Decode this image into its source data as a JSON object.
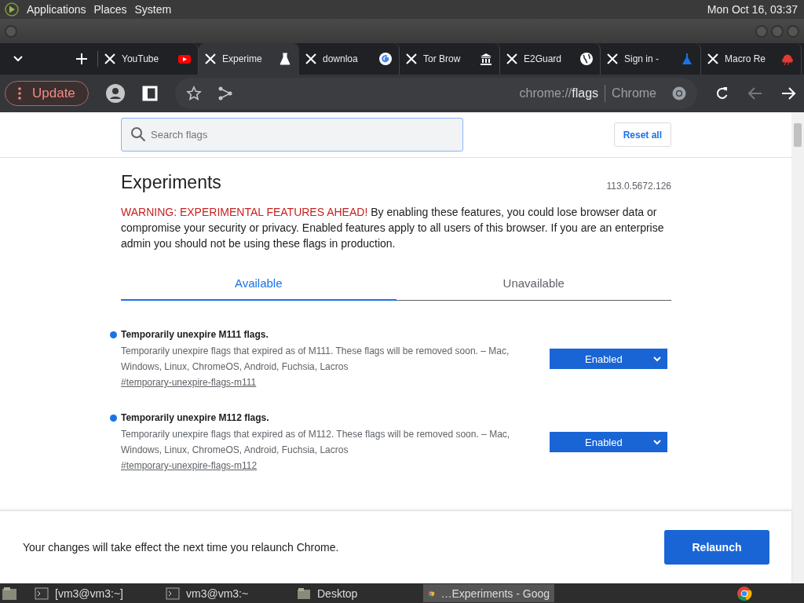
{
  "top_panel": {
    "menus": [
      "Applications",
      "Places",
      "System"
    ],
    "clock": "Mon Oct 16, 03:37"
  },
  "tabs": [
    {
      "title": "YouTube",
      "selected": false
    },
    {
      "title": "Experime",
      "selected": true
    },
    {
      "title": "downloa",
      "selected": false
    },
    {
      "title": "Tor Brow",
      "selected": false
    },
    {
      "title": "E2Guard",
      "selected": false
    },
    {
      "title": "Sign in - ",
      "selected": false
    },
    {
      "title": "Macro Re",
      "selected": false
    }
  ],
  "toolbar": {
    "update_label": "Update",
    "url_scheme": "chrome://",
    "url_path": "flags",
    "url_site": "Chrome"
  },
  "search": {
    "placeholder": "Search flags"
  },
  "reset_label": "Reset all",
  "heading": "Experiments",
  "version": "113.0.5672.126",
  "warning_lead": "WARNING: EXPERIMENTAL FEATURES AHEAD!",
  "warning_text": "By enabling these features, you could lose browser data or compromise your security or privacy. Enabled features apply to all users of this browser. If you are an enterprise admin you should not be using these flags in production.",
  "view_tabs": [
    {
      "label": "Available",
      "selected": true
    },
    {
      "label": "Unavailable",
      "selected": false
    }
  ],
  "flags": [
    {
      "title": "Temporarily unexpire M111 flags.",
      "description": "Temporarily unexpire flags that expired as of M111. These flags will be removed soon. – Mac, Windows, Linux, ChromeOS, Android, Fuchsia, Lacros",
      "link": "#temporary-unexpire-flags-m111",
      "value": "Enabled",
      "modified": true
    },
    {
      "title": "Temporarily unexpire M112 flags.",
      "description": "Temporarily unexpire flags that expired as of M112. These flags will be removed soon. – Mac, Windows, Linux, ChromeOS, Android, Fuchsia, Lacros",
      "link": "#temporary-unexpire-flags-m112",
      "value": "Enabled",
      "modified": true
    }
  ],
  "relaunch_bar": {
    "message": "Your changes will take effect the next time you relaunch Chrome.",
    "button": "Relaunch"
  },
  "taskbar": [
    {
      "label": "[vm3@vm3:~]",
      "kind": "terminal",
      "selected": false
    },
    {
      "label": "vm3@vm3:~",
      "kind": "terminal",
      "selected": false
    },
    {
      "label": "Desktop",
      "kind": "folder",
      "selected": false
    },
    {
      "label": "…Experiments - Goog",
      "kind": "browser",
      "selected": true
    }
  ]
}
